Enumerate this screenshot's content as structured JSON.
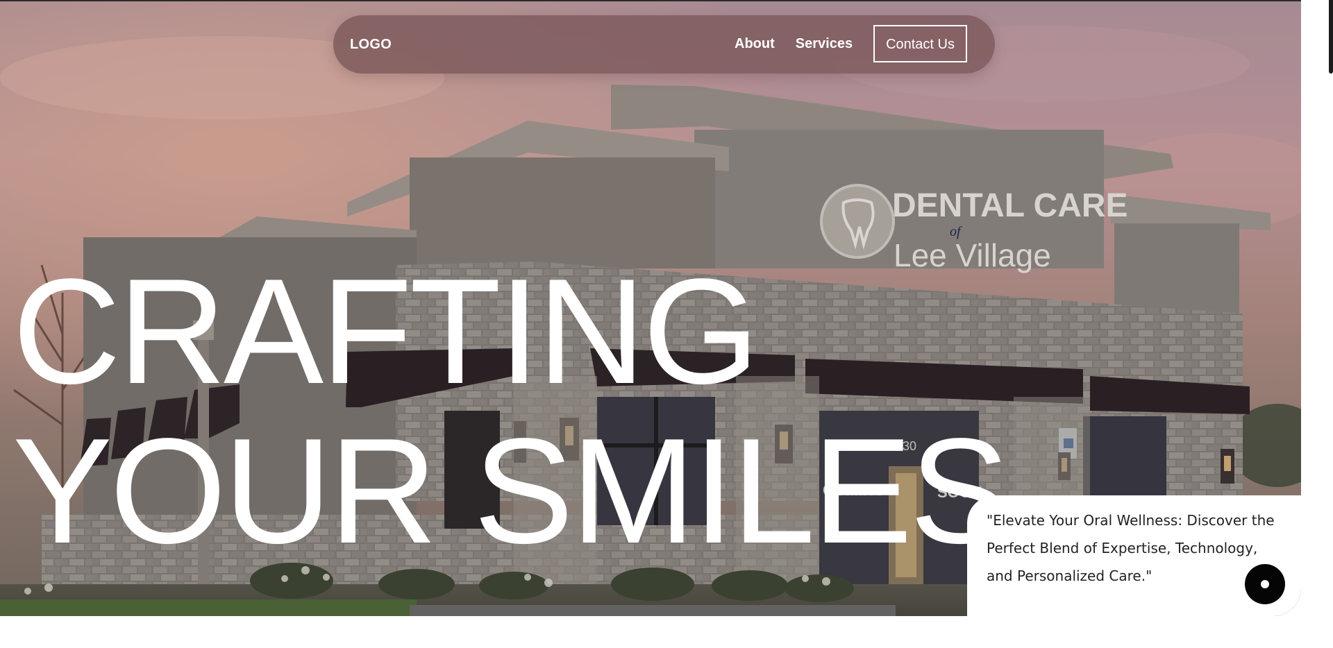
{
  "nav": {
    "logo": "LOGO",
    "links": [
      {
        "label": "About"
      },
      {
        "label": "Services"
      }
    ],
    "contact_label": "Contact Us"
  },
  "hero": {
    "headline_line1": "CRAFTING",
    "headline_line2": "YOUR SMILES",
    "sign_line1": "DENTAL CARE",
    "sign_line2": "of",
    "sign_line3": "Lee Village",
    "window_left": "COMING",
    "window_right": "SOON",
    "address_number": "730",
    "image_icon": "dental-office-building-photo"
  },
  "quote": {
    "text": "\"Elevate Your Oral Wellness: Discover the Perfect Blend of Expertise, Technology, and Personalized Care.\"",
    "button_icon": "dot-icon"
  },
  "colors": {
    "navbar": "#7f5c5f",
    "headline": "#ffffff",
    "button": "#050505"
  }
}
